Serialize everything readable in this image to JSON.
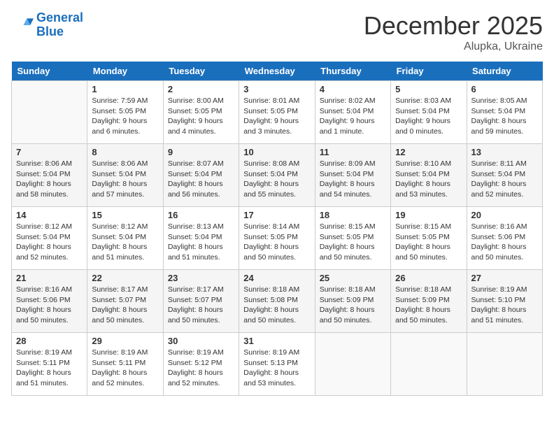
{
  "header": {
    "logo_line1": "General",
    "logo_line2": "Blue",
    "title": "December 2025",
    "subtitle": "Alupka, Ukraine"
  },
  "weekdays": [
    "Sunday",
    "Monday",
    "Tuesday",
    "Wednesday",
    "Thursday",
    "Friday",
    "Saturday"
  ],
  "weeks": [
    [
      {
        "day": "",
        "info": ""
      },
      {
        "day": "1",
        "info": "Sunrise: 7:59 AM\nSunset: 5:05 PM\nDaylight: 9 hours\nand 6 minutes."
      },
      {
        "day": "2",
        "info": "Sunrise: 8:00 AM\nSunset: 5:05 PM\nDaylight: 9 hours\nand 4 minutes."
      },
      {
        "day": "3",
        "info": "Sunrise: 8:01 AM\nSunset: 5:05 PM\nDaylight: 9 hours\nand 3 minutes."
      },
      {
        "day": "4",
        "info": "Sunrise: 8:02 AM\nSunset: 5:04 PM\nDaylight: 9 hours\nand 1 minute."
      },
      {
        "day": "5",
        "info": "Sunrise: 8:03 AM\nSunset: 5:04 PM\nDaylight: 9 hours\nand 0 minutes."
      },
      {
        "day": "6",
        "info": "Sunrise: 8:05 AM\nSunset: 5:04 PM\nDaylight: 8 hours\nand 59 minutes."
      }
    ],
    [
      {
        "day": "7",
        "info": "Sunrise: 8:06 AM\nSunset: 5:04 PM\nDaylight: 8 hours\nand 58 minutes."
      },
      {
        "day": "8",
        "info": "Sunrise: 8:06 AM\nSunset: 5:04 PM\nDaylight: 8 hours\nand 57 minutes."
      },
      {
        "day": "9",
        "info": "Sunrise: 8:07 AM\nSunset: 5:04 PM\nDaylight: 8 hours\nand 56 minutes."
      },
      {
        "day": "10",
        "info": "Sunrise: 8:08 AM\nSunset: 5:04 PM\nDaylight: 8 hours\nand 55 minutes."
      },
      {
        "day": "11",
        "info": "Sunrise: 8:09 AM\nSunset: 5:04 PM\nDaylight: 8 hours\nand 54 minutes."
      },
      {
        "day": "12",
        "info": "Sunrise: 8:10 AM\nSunset: 5:04 PM\nDaylight: 8 hours\nand 53 minutes."
      },
      {
        "day": "13",
        "info": "Sunrise: 8:11 AM\nSunset: 5:04 PM\nDaylight: 8 hours\nand 52 minutes."
      }
    ],
    [
      {
        "day": "14",
        "info": "Sunrise: 8:12 AM\nSunset: 5:04 PM\nDaylight: 8 hours\nand 52 minutes."
      },
      {
        "day": "15",
        "info": "Sunrise: 8:12 AM\nSunset: 5:04 PM\nDaylight: 8 hours\nand 51 minutes."
      },
      {
        "day": "16",
        "info": "Sunrise: 8:13 AM\nSunset: 5:04 PM\nDaylight: 8 hours\nand 51 minutes."
      },
      {
        "day": "17",
        "info": "Sunrise: 8:14 AM\nSunset: 5:05 PM\nDaylight: 8 hours\nand 50 minutes."
      },
      {
        "day": "18",
        "info": "Sunrise: 8:15 AM\nSunset: 5:05 PM\nDaylight: 8 hours\nand 50 minutes."
      },
      {
        "day": "19",
        "info": "Sunrise: 8:15 AM\nSunset: 5:05 PM\nDaylight: 8 hours\nand 50 minutes."
      },
      {
        "day": "20",
        "info": "Sunrise: 8:16 AM\nSunset: 5:06 PM\nDaylight: 8 hours\nand 50 minutes."
      }
    ],
    [
      {
        "day": "21",
        "info": "Sunrise: 8:16 AM\nSunset: 5:06 PM\nDaylight: 8 hours\nand 50 minutes."
      },
      {
        "day": "22",
        "info": "Sunrise: 8:17 AM\nSunset: 5:07 PM\nDaylight: 8 hours\nand 50 minutes."
      },
      {
        "day": "23",
        "info": "Sunrise: 8:17 AM\nSunset: 5:07 PM\nDaylight: 8 hours\nand 50 minutes."
      },
      {
        "day": "24",
        "info": "Sunrise: 8:18 AM\nSunset: 5:08 PM\nDaylight: 8 hours\nand 50 minutes."
      },
      {
        "day": "25",
        "info": "Sunrise: 8:18 AM\nSunset: 5:09 PM\nDaylight: 8 hours\nand 50 minutes."
      },
      {
        "day": "26",
        "info": "Sunrise: 8:18 AM\nSunset: 5:09 PM\nDaylight: 8 hours\nand 50 minutes."
      },
      {
        "day": "27",
        "info": "Sunrise: 8:19 AM\nSunset: 5:10 PM\nDaylight: 8 hours\nand 51 minutes."
      }
    ],
    [
      {
        "day": "28",
        "info": "Sunrise: 8:19 AM\nSunset: 5:11 PM\nDaylight: 8 hours\nand 51 minutes."
      },
      {
        "day": "29",
        "info": "Sunrise: 8:19 AM\nSunset: 5:11 PM\nDaylight: 8 hours\nand 52 minutes."
      },
      {
        "day": "30",
        "info": "Sunrise: 8:19 AM\nSunset: 5:12 PM\nDaylight: 8 hours\nand 52 minutes."
      },
      {
        "day": "31",
        "info": "Sunrise: 8:19 AM\nSunset: 5:13 PM\nDaylight: 8 hours\nand 53 minutes."
      },
      {
        "day": "",
        "info": ""
      },
      {
        "day": "",
        "info": ""
      },
      {
        "day": "",
        "info": ""
      }
    ]
  ]
}
